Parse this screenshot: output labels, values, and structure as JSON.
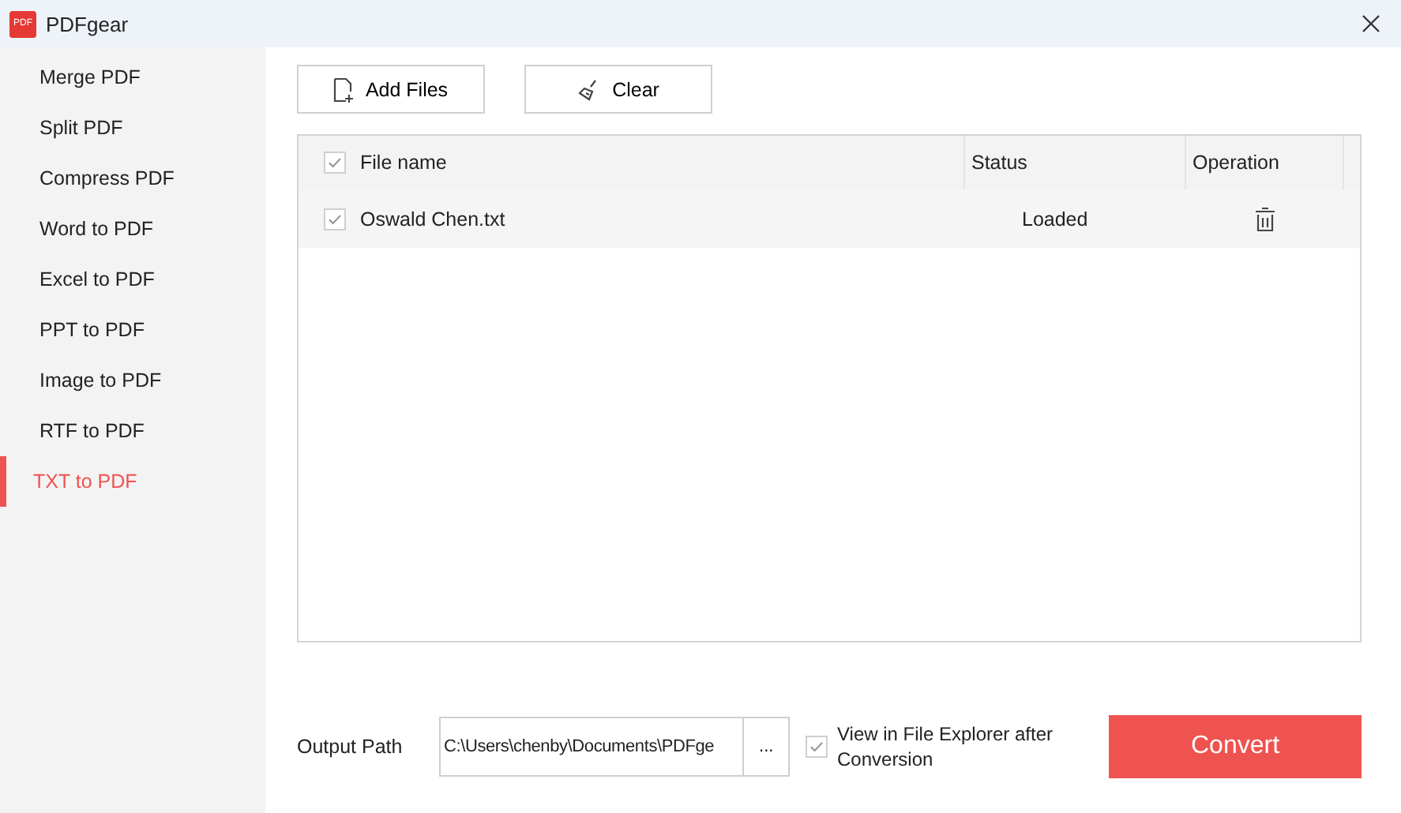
{
  "window": {
    "title": "PDFgear",
    "logo_text": "PDF"
  },
  "sidebar": {
    "items": [
      {
        "label": "Merge PDF",
        "selected": false
      },
      {
        "label": "Split PDF",
        "selected": false
      },
      {
        "label": "Compress PDF",
        "selected": false
      },
      {
        "label": "Word to PDF",
        "selected": false
      },
      {
        "label": "Excel to PDF",
        "selected": false
      },
      {
        "label": "PPT to PDF",
        "selected": false
      },
      {
        "label": "Image to PDF",
        "selected": false
      },
      {
        "label": "RTF to PDF",
        "selected": false
      },
      {
        "label": "TXT to PDF",
        "selected": true
      }
    ]
  },
  "toolbar": {
    "buttons": [
      {
        "label": "Add Files",
        "kind": "add"
      },
      {
        "label": "Clear",
        "kind": "clear"
      }
    ]
  },
  "table": {
    "select_all_checked": true,
    "columns": [
      "File name",
      "Status",
      "Operation"
    ],
    "rows": [
      {
        "name": "Oswald Chen.txt",
        "status": "Loaded",
        "checked": true
      }
    ]
  },
  "output": {
    "label": "Output Path",
    "path": "C:\\Users\\chenby\\Documents\\PDFge",
    "browse": "...",
    "view_after": {
      "label": "View in File Explorer after Conversion",
      "checked": true
    },
    "convert": "Convert"
  }
}
